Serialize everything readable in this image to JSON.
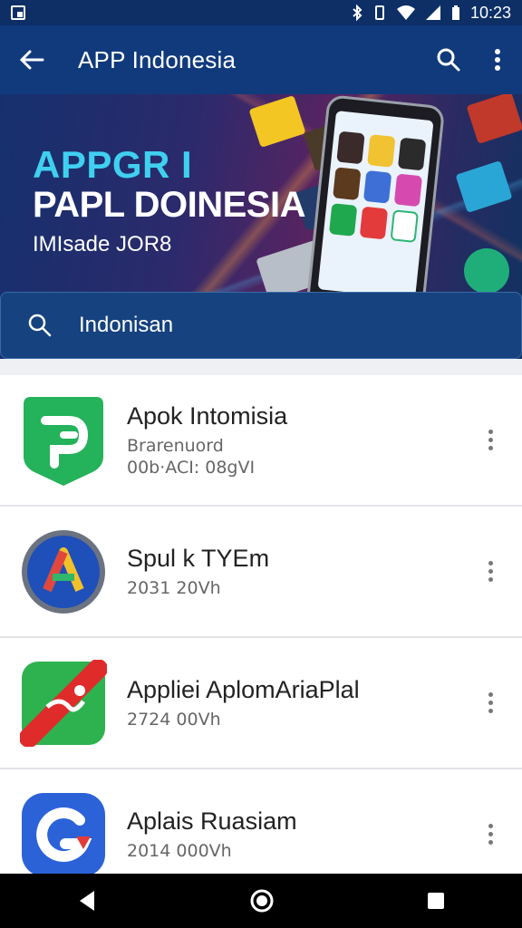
{
  "status": {
    "time": "10:23"
  },
  "appbar": {
    "title": "APP Indonesia",
    "icons": [
      "back-arrow-icon",
      "search-icon",
      "more-vert-icon"
    ]
  },
  "banner": {
    "line1": "APPGR I",
    "line2": "PAPL DOINESIA",
    "line3": "IMIsade JOR8"
  },
  "search": {
    "value": "Indonisan"
  },
  "apps": [
    {
      "name": "Apok Intomisia",
      "line2": "Brarenuord",
      "line3": "00b·ACI: 08gVI"
    },
    {
      "name": "Spul k TYEm",
      "line2": "2031 20Vh",
      "line3": ""
    },
    {
      "name": "Appliei AplomAriaPlal",
      "line2": "2724 00Vh",
      "line3": ""
    },
    {
      "name": "Aplais Ruasiam",
      "line2": "2014 000Vh",
      "line3": ""
    }
  ],
  "colors": {
    "appbar": "#113a7d",
    "statusbar": "#0d2f66",
    "accent": "#3fd0f0"
  }
}
